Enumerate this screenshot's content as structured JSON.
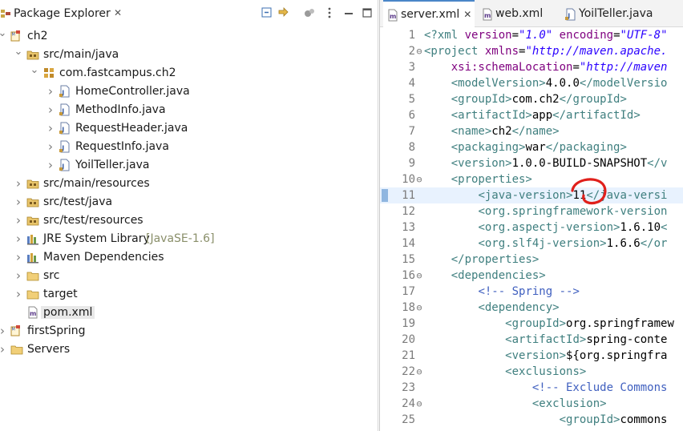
{
  "package_explorer": {
    "title": "Package Explorer",
    "close_glyph": "✕",
    "toolbar": [
      "collapse-all-icon",
      "link-with-editor-icon",
      "filters-icon",
      "view-menu-icon",
      "minimize-icon",
      "maximize-icon"
    ],
    "tree": [
      {
        "label": "ch2",
        "depth": 0,
        "icon": "maven-project-icon",
        "expanded": true
      },
      {
        "label": "src/main/java",
        "depth": 1,
        "icon": "source-folder-icon",
        "expanded": true
      },
      {
        "label": "com.fastcampus.ch2",
        "depth": 2,
        "icon": "package-icon",
        "expanded": true
      },
      {
        "label": "HomeController.java",
        "depth": 3,
        "icon": "java-file-icon",
        "expanded": false
      },
      {
        "label": "MethodInfo.java",
        "depth": 3,
        "icon": "java-file-icon",
        "expanded": false
      },
      {
        "label": "RequestHeader.java",
        "depth": 3,
        "icon": "java-file-icon",
        "expanded": false
      },
      {
        "label": "RequestInfo.java",
        "depth": 3,
        "icon": "java-file-icon",
        "expanded": false
      },
      {
        "label": "YoilTeller.java",
        "depth": 3,
        "icon": "java-file-icon",
        "expanded": false
      },
      {
        "label": "src/main/resources",
        "depth": 1,
        "icon": "source-folder-icon",
        "expanded": false
      },
      {
        "label": "src/test/java",
        "depth": 1,
        "icon": "source-folder-icon",
        "expanded": false
      },
      {
        "label": "src/test/resources",
        "depth": 1,
        "icon": "source-folder-icon",
        "expanded": false
      },
      {
        "label": "JRE System Library",
        "decoration": "[JavaSE-1.6]",
        "depth": 1,
        "icon": "library-icon",
        "expanded": false
      },
      {
        "label": "Maven Dependencies",
        "depth": 1,
        "icon": "library-icon",
        "expanded": false
      },
      {
        "label": "src",
        "depth": 1,
        "icon": "folder-icon",
        "expanded": false
      },
      {
        "label": "target",
        "depth": 1,
        "icon": "folder-icon",
        "expanded": false
      },
      {
        "label": "pom.xml",
        "depth": 1,
        "icon": "xml-file-icon",
        "expanded": null,
        "selected": true
      },
      {
        "label": "firstSpring",
        "depth": 0,
        "icon": "maven-project-icon",
        "expanded": false
      },
      {
        "label": "Servers",
        "depth": 0,
        "icon": "folder-icon",
        "expanded": false
      }
    ]
  },
  "editor": {
    "tabs": [
      {
        "label": "server.xml",
        "active": true,
        "icon": "xml-file-icon",
        "close_glyph": "✕"
      },
      {
        "label": "web.xml",
        "active": false,
        "icon": "xml-file-icon"
      },
      {
        "label": "YoilTeller.java",
        "active": false,
        "icon": "java-file-icon"
      }
    ],
    "highlighted_line": 11,
    "lines": [
      {
        "n": "1",
        "fold": "",
        "html": "<span class='tag'>&lt;?xml</span> <span class='att'>version</span>=<span class='str'>\"1.0\"</span> <span class='att'>encoding</span>=<span class='str'>\"UTF-8\"</span>"
      },
      {
        "n": "2",
        "fold": "⊖",
        "html": "<span class='tag'>&lt;project</span> <span class='att'>xmlns</span>=<span class='str'>\"http://maven.apache.</span>"
      },
      {
        "n": "3",
        "fold": "",
        "html": "    <span class='att'>xsi:schemaLocation</span>=<span class='str'>\"http://maven</span>"
      },
      {
        "n": "4",
        "fold": "",
        "html": "    <span class='tag'>&lt;modelVersion&gt;</span>4.0.0<span class='tag'>&lt;/modelVersio</span>"
      },
      {
        "n": "5",
        "fold": "",
        "html": "    <span class='tag'>&lt;groupId&gt;</span>com.ch2<span class='tag'>&lt;/groupId&gt;</span>"
      },
      {
        "n": "6",
        "fold": "",
        "html": "    <span class='tag'>&lt;artifactId&gt;</span>app<span class='tag'>&lt;/artifactId&gt;</span>"
      },
      {
        "n": "7",
        "fold": "",
        "html": "    <span class='tag'>&lt;name&gt;</span>ch2<span class='tag'>&lt;/name&gt;</span>"
      },
      {
        "n": "8",
        "fold": "",
        "html": "    <span class='tag'>&lt;packaging&gt;</span>war<span class='tag'>&lt;/packaging&gt;</span>"
      },
      {
        "n": "9",
        "fold": "",
        "html": "    <span class='tag'>&lt;version&gt;</span>1.0.0-BUILD-SNAPSHOT<span class='tag'>&lt;/v</span>"
      },
      {
        "n": "10",
        "fold": "⊖",
        "html": "    <span class='tag'>&lt;properties&gt;</span>"
      },
      {
        "n": "11",
        "fold": "",
        "html": "        <span class='tag'>&lt;java-version&gt;</span>11<span class='tag'>&lt;/java-versi</span>"
      },
      {
        "n": "12",
        "fold": "",
        "html": "        <span class='tag'>&lt;org.springframework-version</span>"
      },
      {
        "n": "13",
        "fold": "",
        "html": "        <span class='tag'>&lt;org.aspectj-version&gt;</span>1.6.10<span class='tag'>&lt;</span>"
      },
      {
        "n": "14",
        "fold": "",
        "html": "        <span class='tag'>&lt;org.slf4j-version&gt;</span>1.6.6<span class='tag'>&lt;/or</span>"
      },
      {
        "n": "15",
        "fold": "",
        "html": "    <span class='tag'>&lt;/properties&gt;</span>"
      },
      {
        "n": "16",
        "fold": "⊖",
        "html": "    <span class='tag'>&lt;dependencies&gt;</span>"
      },
      {
        "n": "17",
        "fold": "",
        "html": "        <span class='cmt'>&lt;!-- Spring --&gt;</span>"
      },
      {
        "n": "18",
        "fold": "⊖",
        "html": "        <span class='tag'>&lt;dependency&gt;</span>"
      },
      {
        "n": "19",
        "fold": "",
        "html": "            <span class='tag'>&lt;groupId&gt;</span>org.springframew"
      },
      {
        "n": "20",
        "fold": "",
        "html": "            <span class='tag'>&lt;artifactId&gt;</span>spring-conte"
      },
      {
        "n": "21",
        "fold": "",
        "html": "            <span class='tag'>&lt;version&gt;</span>${org.springfra"
      },
      {
        "n": "22",
        "fold": "⊖",
        "html": "            <span class='tag'>&lt;exclusions&gt;</span>"
      },
      {
        "n": "23",
        "fold": "",
        "html": "                <span class='cmt'>&lt;!-- Exclude Commons</span>"
      },
      {
        "n": "24",
        "fold": "⊖",
        "html": "                <span class='tag'>&lt;exclusion&gt;</span>"
      },
      {
        "n": "25",
        "fold": "",
        "html": "                    <span class='tag'>&lt;groupId&gt;</span>commons"
      }
    ]
  },
  "colors": {
    "tag": "#3f7f7f",
    "attribute": "#7f007f",
    "string": "#2a00ff",
    "comment": "#3f5fbf",
    "line_highlight": "#e8f2fe",
    "annotation_red": "#e0201b"
  }
}
